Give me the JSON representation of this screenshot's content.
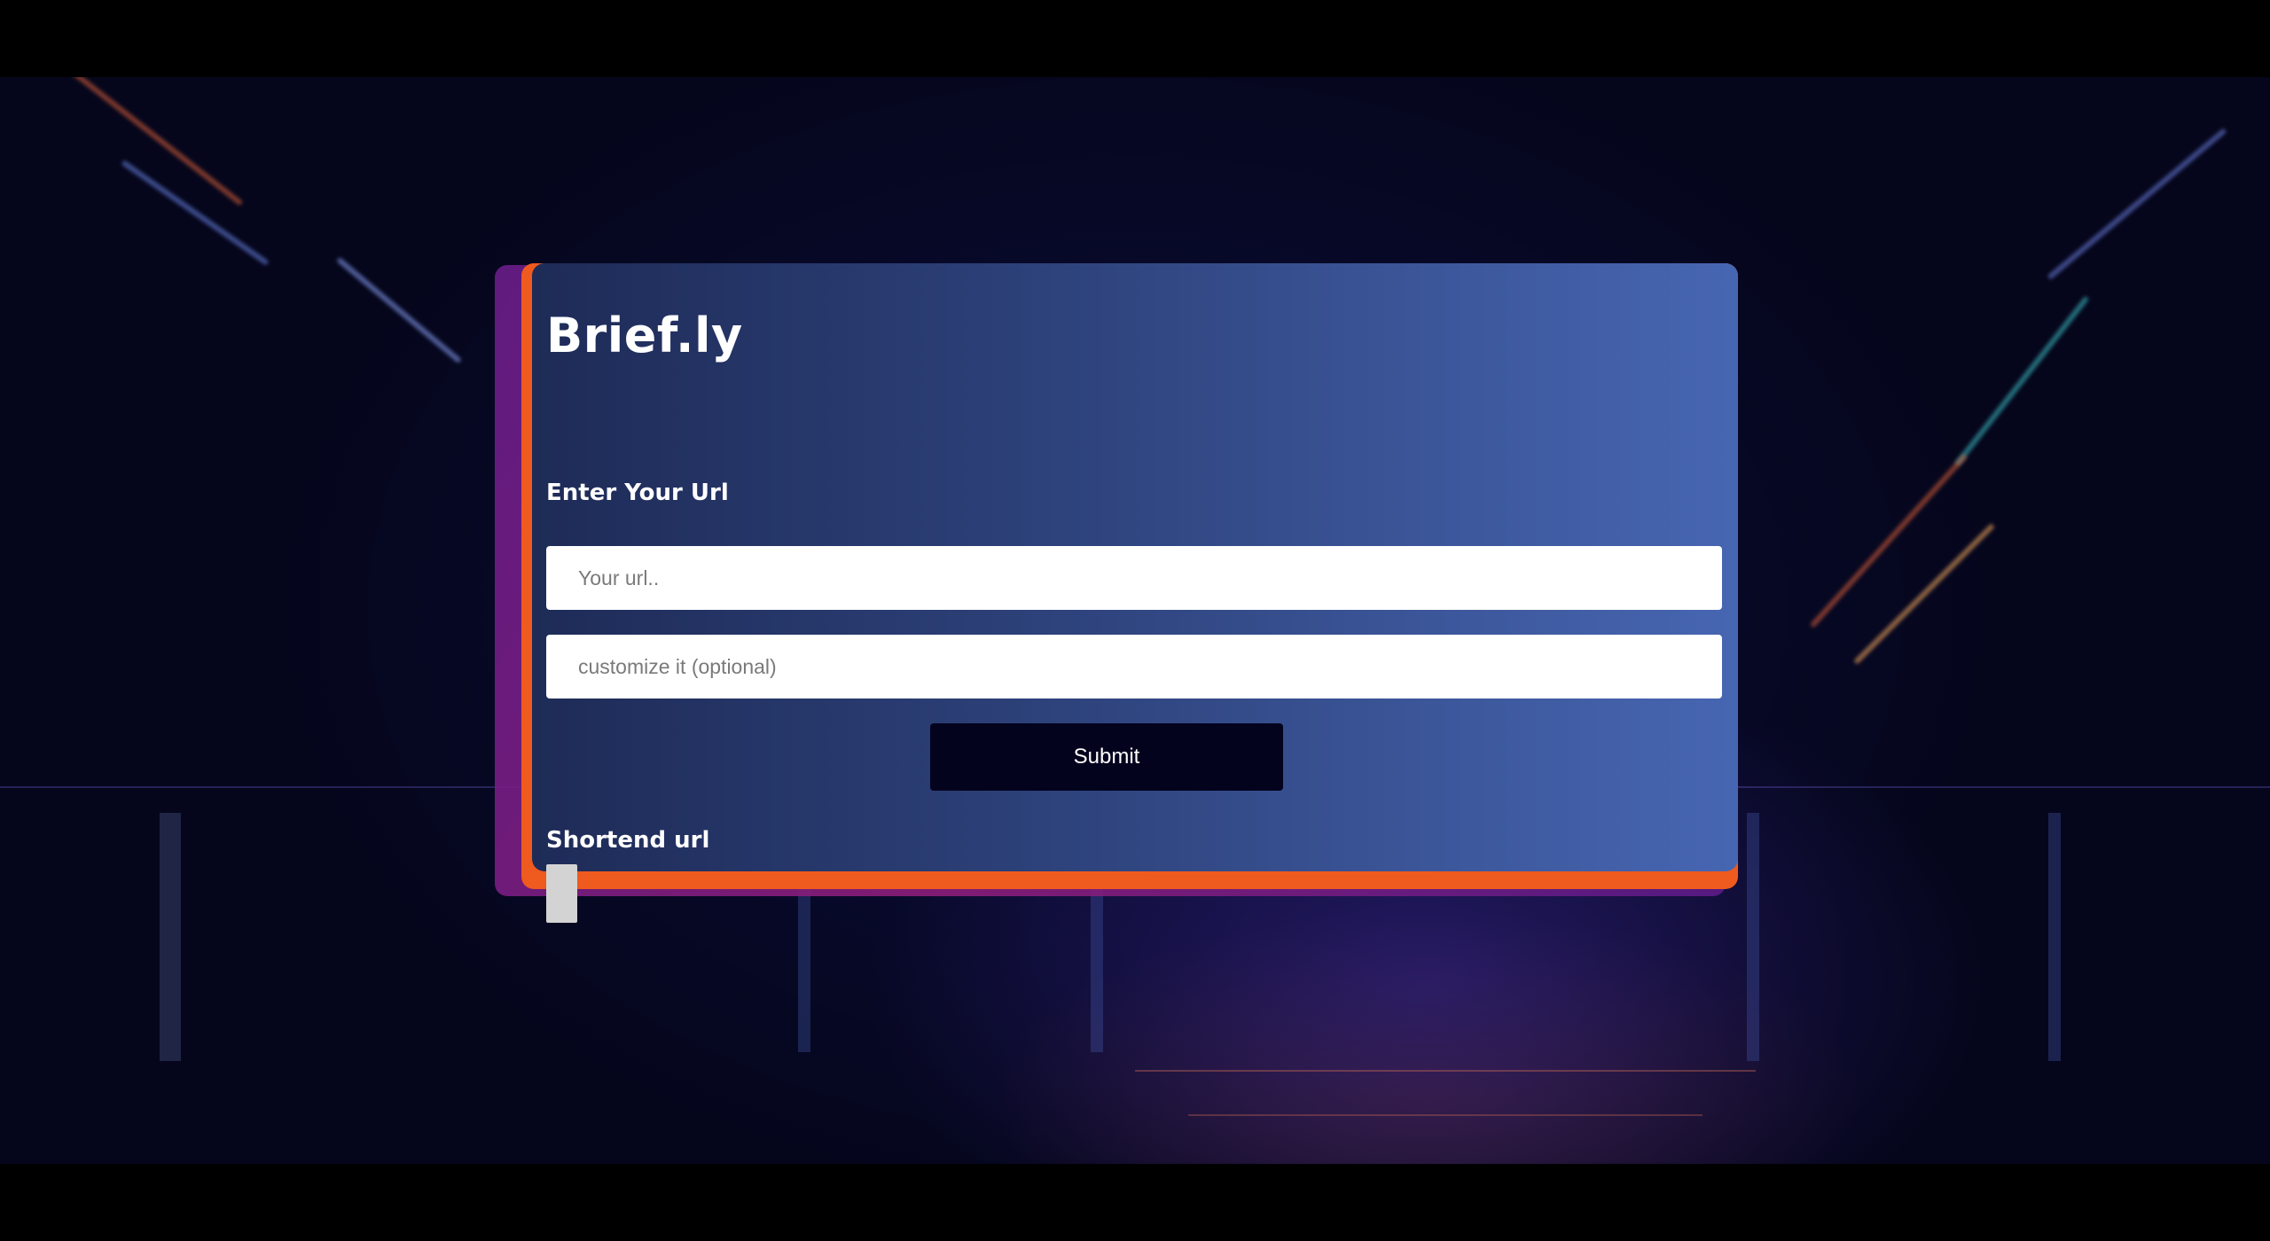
{
  "app": {
    "brand": "Brief.ly"
  },
  "form": {
    "url_label": "Enter Your Url",
    "url_placeholder": "Your url..",
    "custom_placeholder": "customize it (optional)",
    "submit_label": "Submit"
  },
  "result": {
    "label": "Shortend url",
    "value": ""
  },
  "colors": {
    "card_gradient_start": "#1e2b57",
    "card_gradient_end": "#4766b2",
    "accent_orange": "#ef5a1e",
    "accent_purple": "#8d1d7a",
    "button_bg": "#04031e",
    "page_bg": "#05061c"
  }
}
